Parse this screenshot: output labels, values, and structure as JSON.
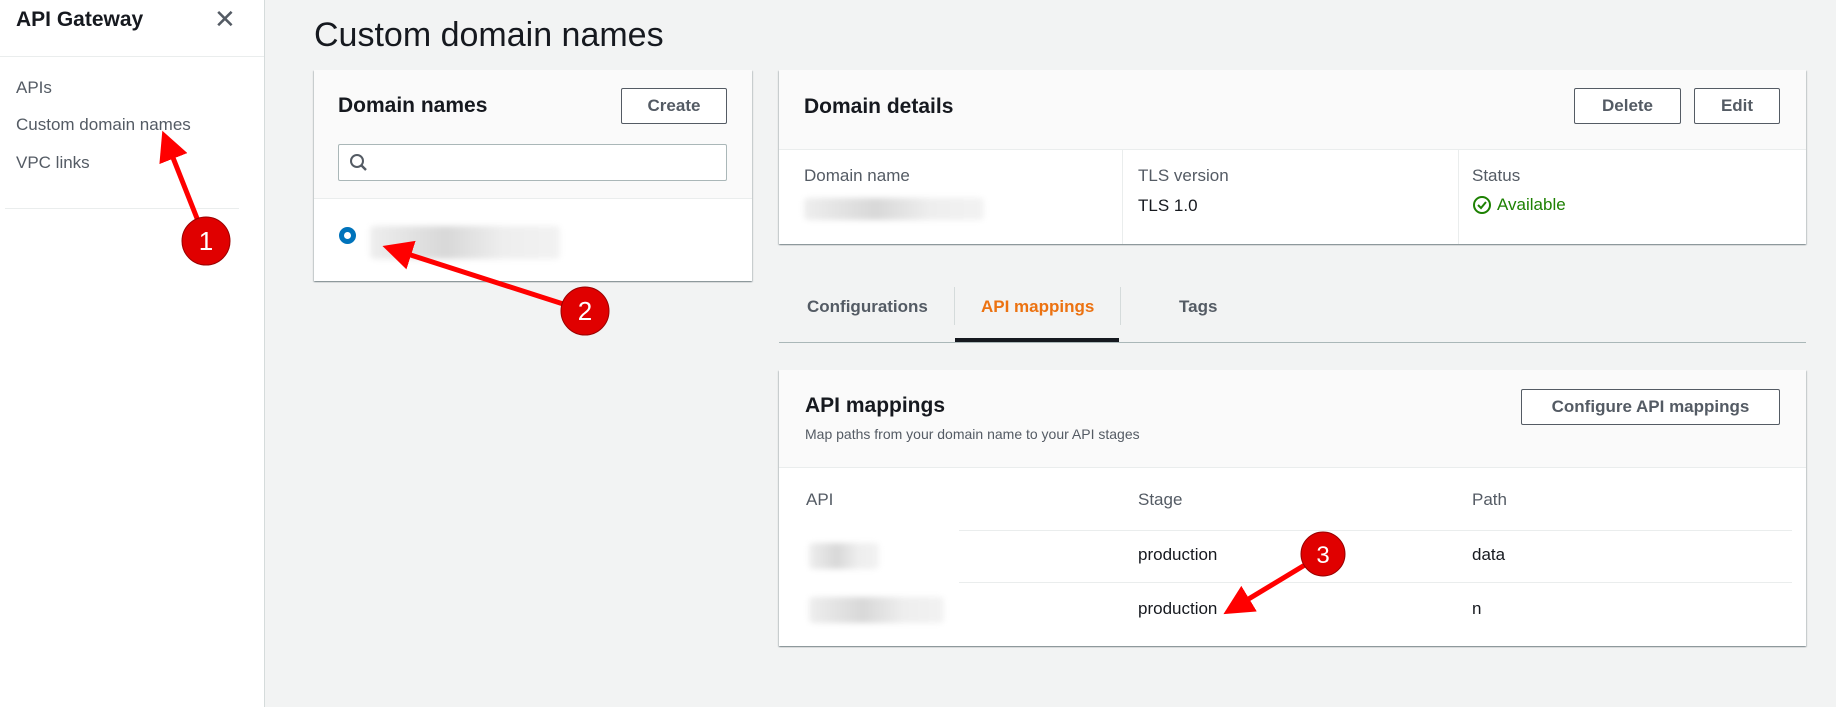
{
  "sidebar": {
    "title": "API Gateway",
    "close_icon": "close-icon",
    "items": [
      {
        "label": "APIs"
      },
      {
        "label": "Custom domain names"
      },
      {
        "label": "VPC links"
      }
    ]
  },
  "page": {
    "title": "Custom domain names"
  },
  "domain_names": {
    "title": "Domain names",
    "create_label": "Create",
    "search_placeholder": "",
    "search_icon": "search-icon",
    "selected_item": "(blurred domain)"
  },
  "domain_details": {
    "title": "Domain details",
    "delete_label": "Delete",
    "edit_label": "Edit",
    "fields": [
      {
        "label": "Domain name",
        "value": ""
      },
      {
        "label": "TLS version",
        "value": "TLS 1.0"
      },
      {
        "label": "Status",
        "value": "Available"
      }
    ]
  },
  "tabs": [
    {
      "label": "Configurations"
    },
    {
      "label": "API mappings",
      "active": true
    },
    {
      "label": "Tags"
    }
  ],
  "api_mappings": {
    "title": "API mappings",
    "subtitle": "Map paths from your domain name to your API stages",
    "configure_label": "Configure API mappings",
    "columns": [
      "API",
      "Stage",
      "Path"
    ],
    "rows": [
      {
        "api": "",
        "stage": "production",
        "path": "data"
      },
      {
        "api": "",
        "stage": "production",
        "path": "n"
      }
    ]
  },
  "annotations": [
    "1",
    "2",
    "3"
  ],
  "colors": {
    "accent": "#ec7211",
    "radio": "#0073bb",
    "success": "#1d8102",
    "annotation": "#ff0000"
  }
}
